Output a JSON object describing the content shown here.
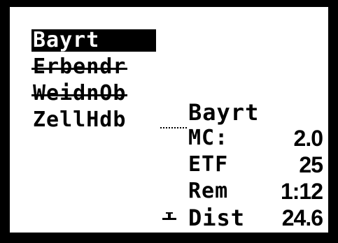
{
  "route": {
    "waypoints": [
      {
        "label": "Bayrt",
        "state": "selected"
      },
      {
        "label": "Erbendr",
        "state": "passed"
      },
      {
        "label": "WeidnOb",
        "state": "passed"
      },
      {
        "label": "ZellHdb",
        "state": "upcoming"
      }
    ]
  },
  "info": {
    "title": "Bayrt",
    "rows": [
      {
        "label": "MC:",
        "value": "2.0"
      },
      {
        "label": "ETF",
        "value": "25"
      },
      {
        "label": "Rem",
        "value": "1:12"
      },
      {
        "label": "Dist",
        "value": "24.6"
      }
    ]
  },
  "icons": {
    "position_marker": "glider-position-icon"
  },
  "colors": {
    "lcd_background": "#ffffff",
    "ink": "#000000",
    "bezel": "#000000"
  }
}
